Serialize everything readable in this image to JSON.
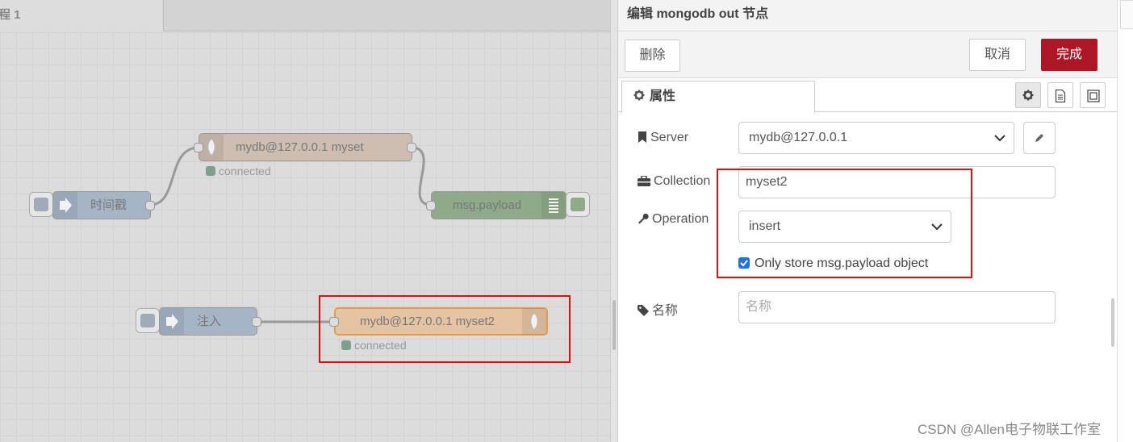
{
  "workspace": {
    "flow_tab": "程 1",
    "nodes": {
      "mongo_in": {
        "label": "mydb@127.0.0.1 myset",
        "status": "connected"
      },
      "timestamp": {
        "label": "时间戳"
      },
      "debug": {
        "label": "msg.payload"
      },
      "inject": {
        "label": "注入"
      },
      "mongo_out": {
        "label": "mydb@127.0.0.1 myset2",
        "status": "connected"
      }
    }
  },
  "tray": {
    "title": "编辑 mongodb out 节点",
    "delete_label": "删除",
    "cancel_label": "取消",
    "done_label": "完成",
    "properties_tab": "属性",
    "server": {
      "label": "Server",
      "value": "mydb@127.0.0.1"
    },
    "collection": {
      "label": "Collection",
      "value": "myset2"
    },
    "operation": {
      "label": "Operation",
      "value": "insert"
    },
    "only_payload": {
      "label": "Only store msg.payload object",
      "checked": true
    },
    "name": {
      "label": "名称",
      "placeholder": "名称"
    }
  },
  "watermark": "CSDN @Allen电子物联工作室",
  "colors": {
    "accent_red": "#ad1625",
    "highlight_red": "#e01010",
    "mongo_node": "#d4c3b5",
    "mongo_node_selected": "#e9c7a2",
    "inject_node": "#a6bbcf",
    "debug_node": "#87a980",
    "status_connected": "#7f9f8b"
  }
}
